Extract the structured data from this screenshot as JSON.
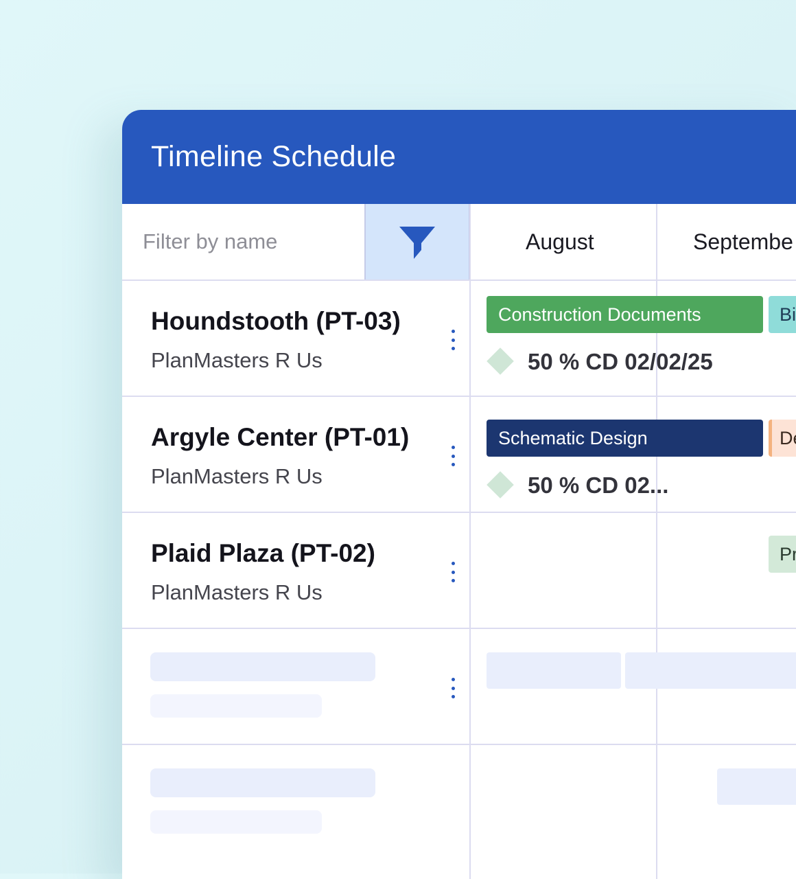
{
  "window": {
    "title": "Timeline Schedule"
  },
  "toolbar": {
    "filter_placeholder": "Filter by name",
    "filter_icon": "funnel-icon",
    "months": [
      "August",
      "Septembe"
    ]
  },
  "rows": [
    {
      "name": "Houndstooth (PT-03)",
      "company": "PlanMasters R Us",
      "phase_label": "Construction Documents",
      "phase_color": "#4ea75d",
      "next_phase_label": "Bi",
      "next_phase_color": "#8fdcd9",
      "milestone": "50 % CD 02/02/25"
    },
    {
      "name": "Argyle Center (PT-01)",
      "company": "PlanMasters R Us",
      "phase_label": "Schematic Design",
      "phase_color": "#1c3670",
      "next_phase_label": "De",
      "next_phase_color": "#fde3d6",
      "milestone": "50 % CD 02..."
    },
    {
      "name": "Plaid Plaza (PT-02)",
      "company": "PlanMasters R Us",
      "next_phase_label": "Pr",
      "next_phase_color": "#d3e9d8"
    }
  ],
  "colors": {
    "header": "#2758be",
    "accent": "#2758be",
    "skeleton": "#e9eefc",
    "milestone": "#cfe6d6"
  }
}
